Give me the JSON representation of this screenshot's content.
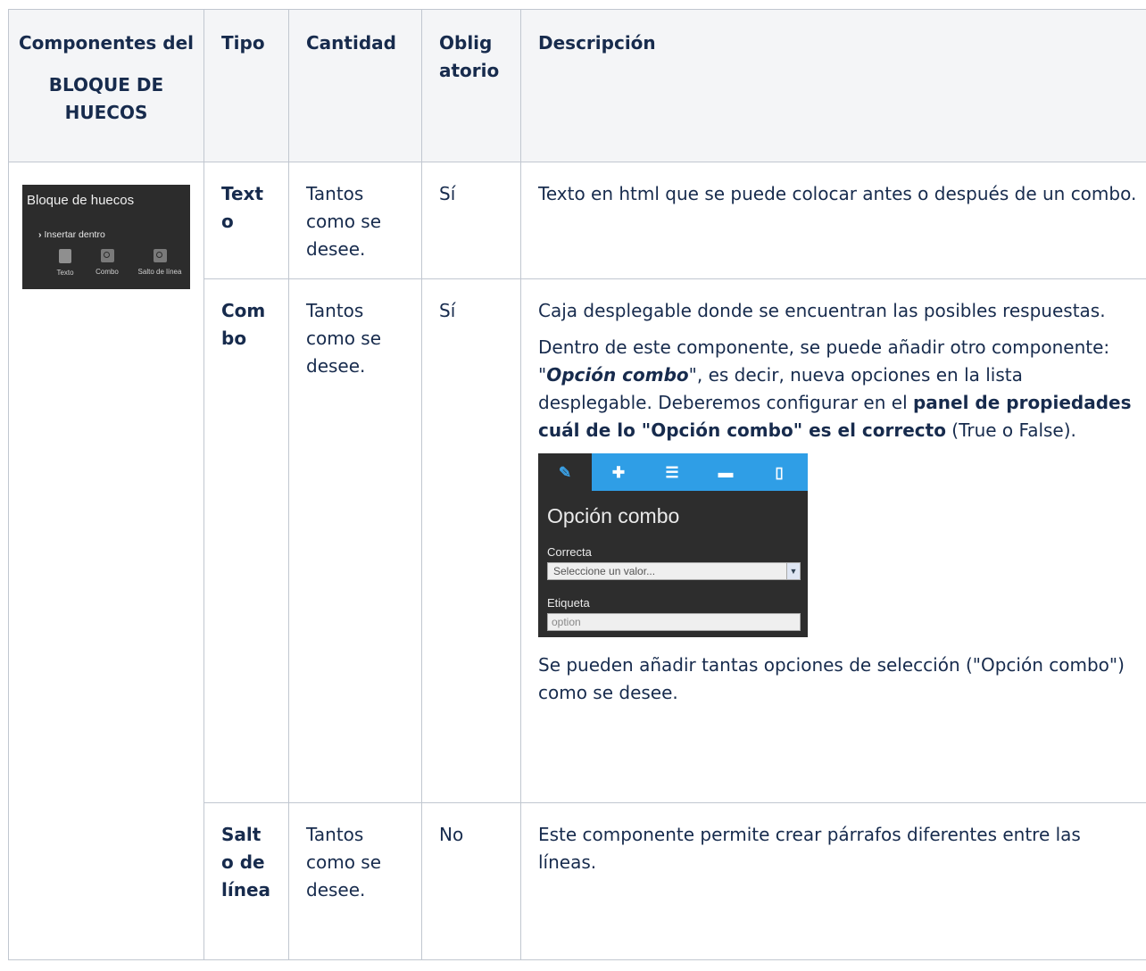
{
  "header": {
    "col1_line1": "Componentes del",
    "col1_line2": "BLOQUE DE HUECOS",
    "tipo": "Tipo",
    "cantidad": "Cantidad",
    "obligatorio": "Obligatorio",
    "descripcion": "Descripción"
  },
  "widget": {
    "title": "Bloque de huecos",
    "insert_label": "Insertar dentro",
    "items": [
      "Texto",
      "Combo",
      "Salto de línea"
    ]
  },
  "rows": [
    {
      "tipo": "Texto",
      "cantidad": "Tantos como se desee.",
      "obligatorio": "Sí",
      "desc": "Texto en html que se puede colocar antes o después de un combo."
    },
    {
      "tipo": "Combo",
      "cantidad": "Tantos como se desee.",
      "obligatorio": "Sí",
      "desc1": "Caja desplegable donde se encuentran las posibles respuestas.",
      "desc2_a": "Dentro de este componente, se puede añadir otro componente: \"",
      "desc2_em": "Opción combo",
      "desc2_b": "\", es decir, nueva opciones en la lista desplegable. Deberemos configurar en el ",
      "desc2_strong": "panel de propiedades cuál de lo \"Opción combo\" es el correcto",
      "desc2_c": " (True o False).",
      "desc3": "Se pueden añadir tantas opciones de selección (\"Opción combo\") como se desee."
    },
    {
      "tipo": "Salto de línea",
      "cantidad": "Tantos como se desee.",
      "obligatorio": "No",
      "desc": "Este componente permite crear párrafos diferentes entre las líneas."
    }
  ],
  "panel": {
    "tabs": [
      "pencil-icon",
      "plus-icon",
      "list-icon",
      "comment-icon",
      "mobile-icon"
    ],
    "title": "Opción combo",
    "field1_label": "Correcta",
    "field1_value": "Seleccione un valor...",
    "field2_label": "Etiqueta",
    "field2_value": "option"
  },
  "colors": {
    "border": "#c1c7d0",
    "header_bg": "#f4f5f7",
    "tab_blue": "#2f9ee6"
  }
}
